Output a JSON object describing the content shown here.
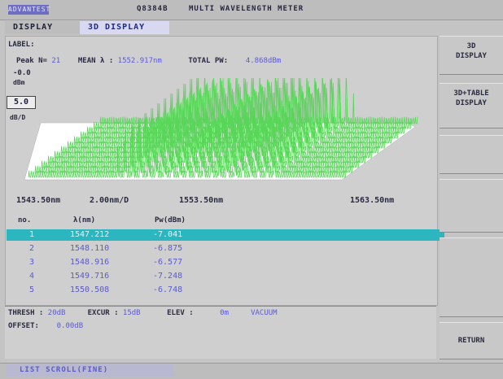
{
  "header": {
    "logo": "ADVANTEST",
    "model": "Q8384B",
    "title": "MULTI WAVELENGTH METER"
  },
  "tabs": [
    {
      "label": "DISPLAY"
    },
    {
      "label": "3D DISPLAY"
    }
  ],
  "label_field": "LABEL:",
  "info": {
    "peak_label": "Peak N=",
    "peak_count": "21",
    "mean_label": "MEAN λ :",
    "mean_value": "1552.917nm",
    "total_label": "TOTAL PW:",
    "total_value": "4.868dBm"
  },
  "yaxis": {
    "ref_value": "-0.0",
    "ref_unit": "dBm",
    "scale_value": "5.0",
    "scale_unit": "dB/D"
  },
  "xaxis": {
    "start": "1543.50nm",
    "step": "2.00nm/D",
    "center": "1553.50nm",
    "end": "1563.50nm"
  },
  "chart_data": {
    "type": "area",
    "title": "",
    "xlabel": "",
    "ylabel": "",
    "x_range": [
      1543.5,
      1563.5
    ],
    "y_range_db": [
      -50,
      0
    ],
    "peak_count": 21,
    "traces": 12,
    "trace_color": "#58d658"
  },
  "table": {
    "headers": [
      "no.",
      "λ(nm)",
      "Pw(dBm)"
    ],
    "rows": [
      {
        "no": "1",
        "wl": "1547.212",
        "pw": "-7.041",
        "selected": true
      },
      {
        "no": "2",
        "wl": "1548.110",
        "pw": "-6.875",
        "selected": false
      },
      {
        "no": "3",
        "wl": "1548.916",
        "pw": "-6.577",
        "selected": false
      },
      {
        "no": "4",
        "wl": "1549.716",
        "pw": "-7.248",
        "selected": false
      },
      {
        "no": "5",
        "wl": "1550.508",
        "pw": "-6.748",
        "selected": false
      }
    ]
  },
  "status": {
    "thresh_label": "THRESH :",
    "thresh_value": "20dB",
    "excur_label": "EXCUR :",
    "excur_value": "15dB",
    "elev_label": "ELEV :",
    "elev_value": "0m",
    "medium": "VACUUM",
    "offset_label": "OFFSET:",
    "offset_value": "0.00dB"
  },
  "footer": {
    "list_scroll": "LIST SCROLL(FINE)"
  },
  "softkeys": [
    {
      "line1": "3D",
      "line2": "DISPLAY"
    },
    {
      "line1": "3D+TABLE",
      "line2": "DISPLAY"
    },
    {
      "line1": "",
      "line2": ""
    },
    {
      "line1": "",
      "line2": ""
    },
    {
      "line1": "",
      "line2": ""
    },
    {
      "line1": "RETURN",
      "line2": ""
    }
  ],
  "colors": {
    "trace": "#58d658",
    "selected_row": "#2cb6bf",
    "value_text": "#5a5adc"
  }
}
